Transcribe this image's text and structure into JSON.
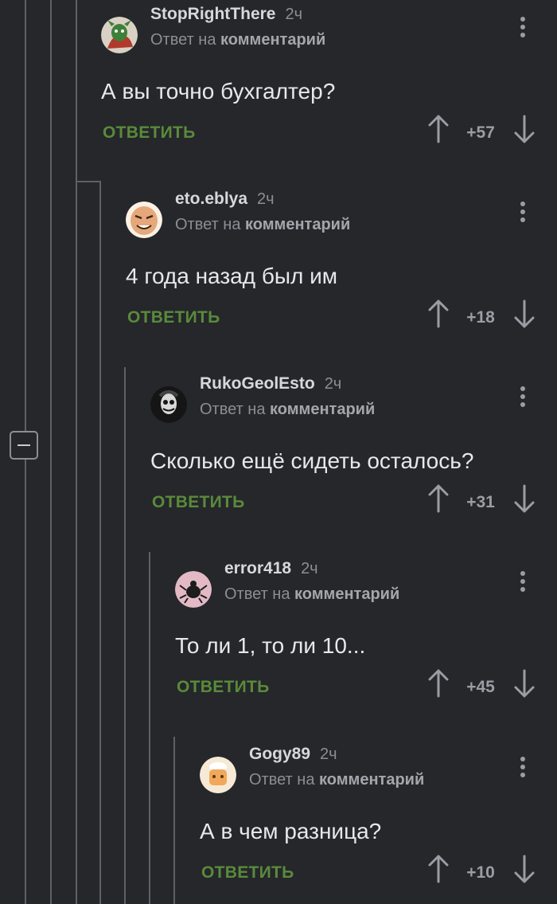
{
  "thread": {
    "collapse_icon": "minus-square-icon",
    "comments": [
      {
        "author": "StopRightThere",
        "time": "2ч",
        "reply_prefix": "Ответ на",
        "reply_target": "комментарий",
        "text": "А вы точно бухгалтер?",
        "reply_label": "ОТВЕТИТЬ",
        "score": "+57",
        "avatar_color": "#7a3a2a"
      },
      {
        "author": "eto.eblya",
        "time": "2ч",
        "reply_prefix": "Ответ на",
        "reply_target": "комментарий",
        "text": "4 года назад был им",
        "reply_label": "ОТВЕТИТЬ",
        "score": "+18",
        "avatar_color": "#e9b48a"
      },
      {
        "author": "RukoGeolEsto",
        "time": "2ч",
        "reply_prefix": "Ответ на",
        "reply_target": "комментарий",
        "text": "Сколько ещё сидеть осталось?",
        "reply_label": "ОТВЕТИТЬ",
        "score": "+31",
        "avatar_color": "#1a1a1a"
      },
      {
        "author": "error418",
        "time": "2ч",
        "reply_prefix": "Ответ на",
        "reply_target": "комментарий",
        "text": "То ли 1, то ли 10...",
        "reply_label": "ОТВЕТИТЬ",
        "score": "+45",
        "avatar_color": "#d6a8b8"
      },
      {
        "author": "Gogy89",
        "time": "2ч",
        "reply_prefix": "Ответ на",
        "reply_target": "комментарий",
        "text": "А в чем разница?",
        "reply_label": "ОТВЕТИТЬ",
        "score": "+10",
        "avatar_color": "#f2e0c0"
      }
    ]
  },
  "colors": {
    "background": "#25272b",
    "reply_green": "#5a8a3a",
    "text": "#e7e8ea",
    "muted": "#8b8e94"
  }
}
